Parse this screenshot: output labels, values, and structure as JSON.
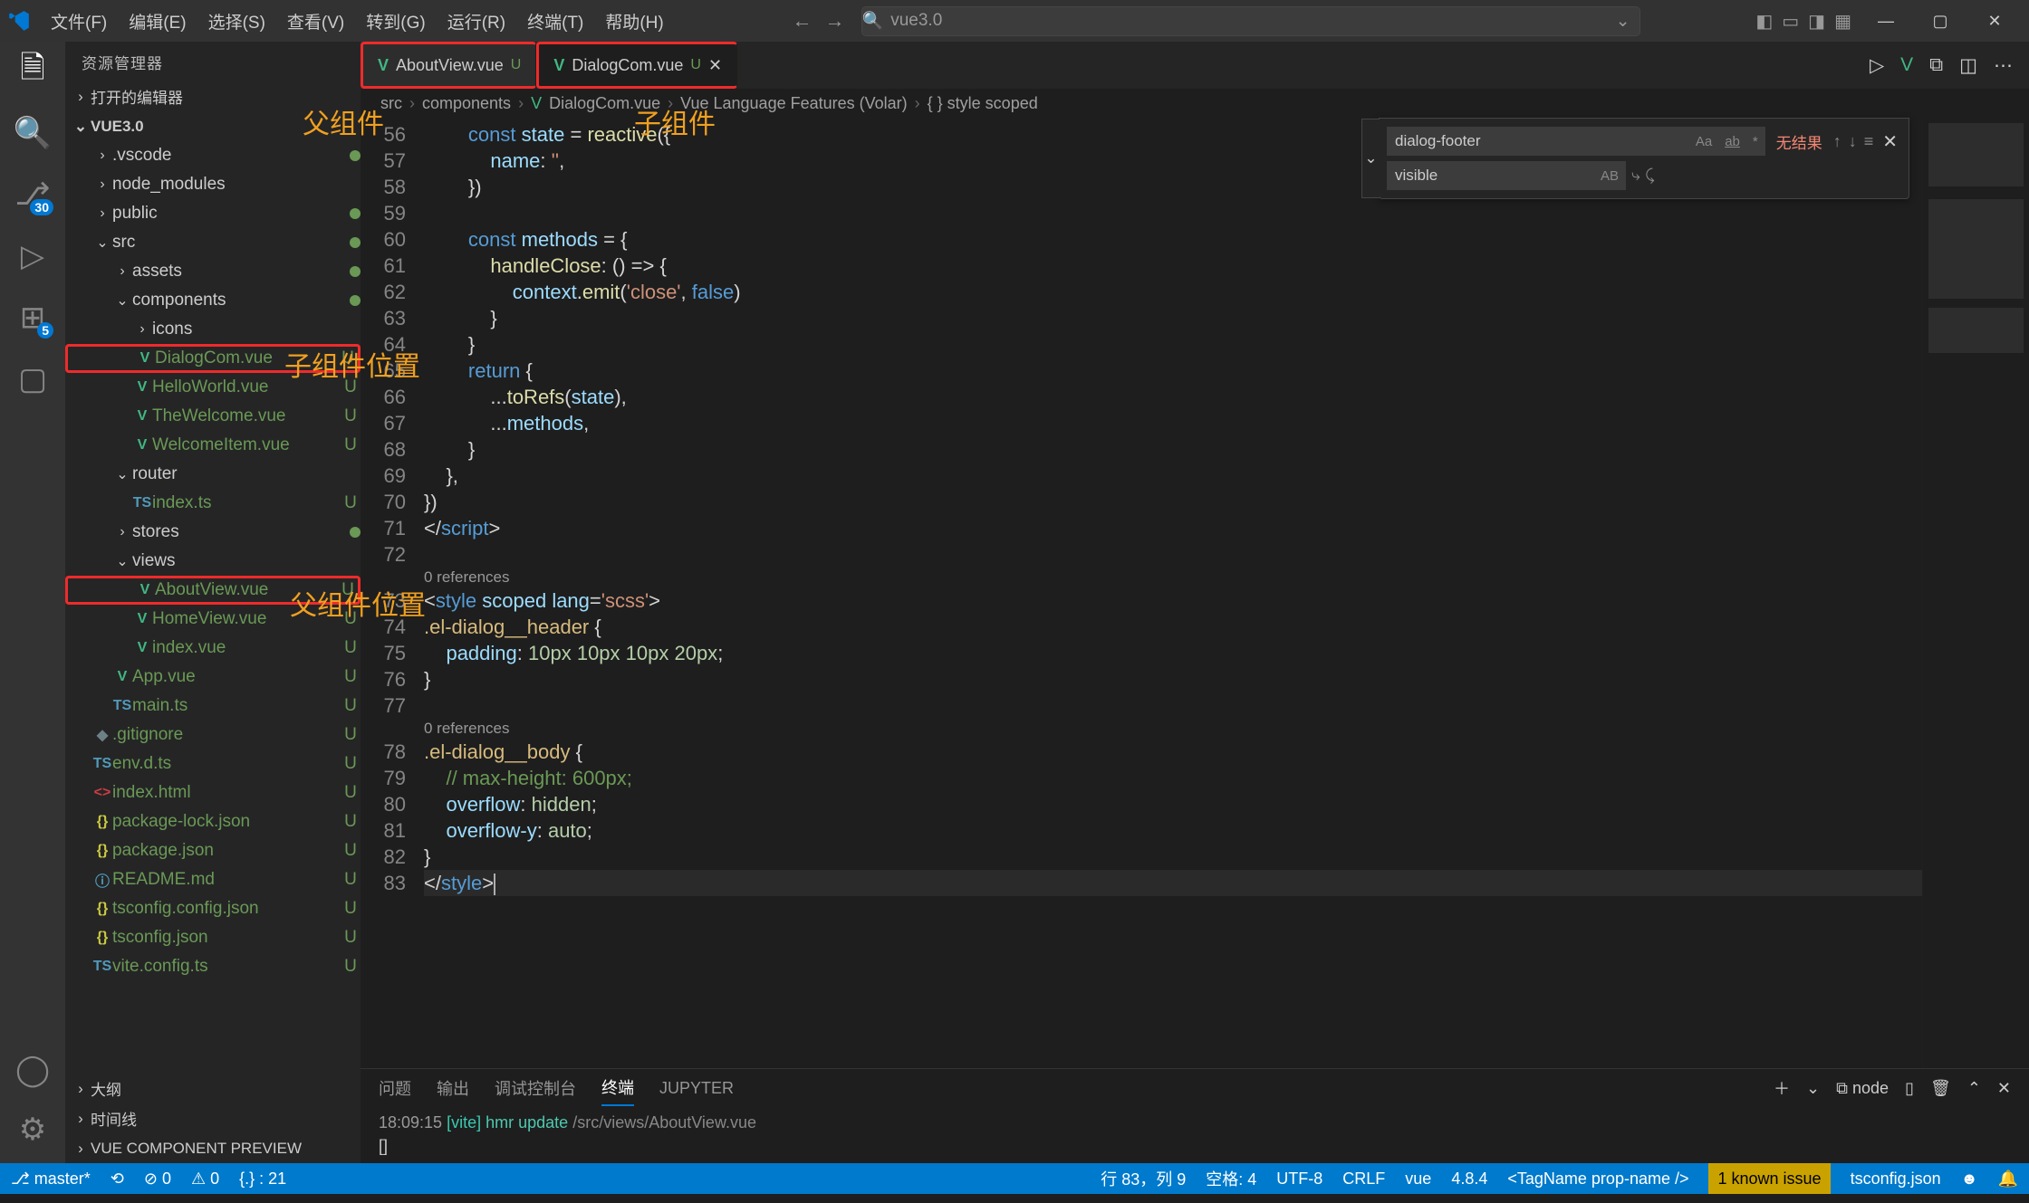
{
  "title": "vue3.0",
  "menu": [
    "文件(F)",
    "编辑(E)",
    "选择(S)",
    "查看(V)",
    "转到(G)",
    "运行(R)",
    "终端(T)",
    "帮助(H)"
  ],
  "search_placeholder": "vue3.0",
  "sidebar_title": "资源管理器",
  "sections": {
    "open_editors": "打开的编辑器",
    "project": "VUE3.0",
    "outline": "大纲",
    "timeline": "时间线",
    "vcp": "VUE COMPONENT PREVIEW"
  },
  "tree": [
    {
      "d": 1,
      "t": "folder",
      "open": false,
      "lbl": ".vscode",
      "dot": true
    },
    {
      "d": 1,
      "t": "folder",
      "open": false,
      "lbl": "node_modules"
    },
    {
      "d": 1,
      "t": "folder",
      "open": false,
      "lbl": "public",
      "dot": true
    },
    {
      "d": 1,
      "t": "folder",
      "open": true,
      "lbl": "src",
      "dot": true
    },
    {
      "d": 2,
      "t": "folder",
      "open": false,
      "lbl": "assets",
      "dot": true
    },
    {
      "d": 2,
      "t": "folder",
      "open": true,
      "lbl": "components",
      "dot": true
    },
    {
      "d": 3,
      "t": "folder",
      "open": false,
      "lbl": "icons",
      "em": true
    },
    {
      "d": 3,
      "t": "vue",
      "lbl": "DialogCom.vue",
      "git": "U",
      "hl": true,
      "red": true
    },
    {
      "d": 3,
      "t": "vue",
      "lbl": "HelloWorld.vue",
      "git": "U"
    },
    {
      "d": 3,
      "t": "vue",
      "lbl": "TheWelcome.vue",
      "git": "U"
    },
    {
      "d": 3,
      "t": "vue",
      "lbl": "WelcomeItem.vue",
      "git": "U"
    },
    {
      "d": 2,
      "t": "folder",
      "open": true,
      "lbl": "router"
    },
    {
      "d": 3,
      "t": "ts",
      "lbl": "index.ts",
      "git": "U"
    },
    {
      "d": 2,
      "t": "folder",
      "open": false,
      "lbl": "stores",
      "dot": true
    },
    {
      "d": 2,
      "t": "folder",
      "open": true,
      "lbl": "views"
    },
    {
      "d": 3,
      "t": "vue",
      "lbl": "AboutView.vue",
      "git": "U",
      "red": true
    },
    {
      "d": 3,
      "t": "vue",
      "lbl": "HomeView.vue",
      "git": "U"
    },
    {
      "d": 3,
      "t": "vue",
      "lbl": "index.vue",
      "git": "U"
    },
    {
      "d": 2,
      "t": "vue",
      "lbl": "App.vue",
      "git": "U"
    },
    {
      "d": 2,
      "t": "ts",
      "lbl": "main.ts",
      "git": "U"
    },
    {
      "d": 1,
      "t": "git",
      "lbl": ".gitignore",
      "git": "U"
    },
    {
      "d": 1,
      "t": "ts",
      "lbl": "env.d.ts",
      "git": "U"
    },
    {
      "d": 1,
      "t": "html",
      "lbl": "index.html",
      "git": "U"
    },
    {
      "d": 1,
      "t": "json",
      "lbl": "package-lock.json",
      "git": "U"
    },
    {
      "d": 1,
      "t": "json",
      "lbl": "package.json",
      "git": "U"
    },
    {
      "d": 1,
      "t": "md",
      "lbl": "README.md",
      "git": "U"
    },
    {
      "d": 1,
      "t": "json",
      "lbl": "tsconfig.config.json",
      "git": "U"
    },
    {
      "d": 1,
      "t": "json",
      "lbl": "tsconfig.json",
      "git": "U"
    },
    {
      "d": 1,
      "t": "ts",
      "lbl": "vite.config.ts",
      "git": "U"
    }
  ],
  "tabs": [
    {
      "lbl": "AboutView.vue",
      "mod": "U",
      "active": false,
      "red": true
    },
    {
      "lbl": "DialogCom.vue",
      "mod": "U",
      "active": true,
      "close": true,
      "red": true
    }
  ],
  "breadcrumb": [
    "src",
    "components",
    "DialogCom.vue",
    "Vue Language Features (Volar)",
    "{ } style scoped"
  ],
  "find": {
    "term": "dialog-footer",
    "replace": "visible",
    "result": "无结果",
    "opts": {
      "case": "Aa",
      "word": "ab",
      "regex": "*",
      "preserve": "AB"
    }
  },
  "code": {
    "start": 56,
    "lines": [
      {
        "n": 56,
        "h": "        <span class='c-kw'>const</span> <span class='c-var'>state</span> <span class='c-pun'>=</span> <span class='c-fn'>reactive</span><span class='c-pun'>({</span>"
      },
      {
        "n": 57,
        "h": "            <span class='c-var'>name</span><span class='c-pun'>:</span> <span class='c-str'>''</span><span class='c-pun'>,</span>"
      },
      {
        "n": 58,
        "h": "        <span class='c-pun'>})</span>"
      },
      {
        "n": 59,
        "h": ""
      },
      {
        "n": 60,
        "h": "        <span class='c-kw'>const</span> <span class='c-var'>methods</span> <span class='c-pun'>= {</span>"
      },
      {
        "n": 61,
        "h": "            <span class='c-fn'>handleClose</span><span class='c-pun'>: () =&gt; {</span>"
      },
      {
        "n": 62,
        "h": "                <span class='c-var'>context</span><span class='c-pun'>.</span><span class='c-fn'>emit</span><span class='c-pun'>(</span><span class='c-str'>'close'</span><span class='c-pun'>,</span> <span class='c-const'>false</span><span class='c-pun'>)</span>"
      },
      {
        "n": 63,
        "h": "            <span class='c-pun'>}</span>"
      },
      {
        "n": 64,
        "h": "        <span class='c-pun'>}</span>"
      },
      {
        "n": 65,
        "h": "        <span class='c-kw'>return</span> <span class='c-pun'>{</span>"
      },
      {
        "n": 66,
        "h": "            <span class='c-pun'>...</span><span class='c-fn'>toRefs</span><span class='c-pun'>(</span><span class='c-var'>state</span><span class='c-pun'>),</span>"
      },
      {
        "n": 67,
        "h": "            <span class='c-pun'>...</span><span class='c-var'>methods</span><span class='c-pun'>,</span>"
      },
      {
        "n": 68,
        "h": "        <span class='c-pun'>}</span>"
      },
      {
        "n": 69,
        "h": "    <span class='c-pun'>},</span>"
      },
      {
        "n": 70,
        "h": "<span class='c-pun'>})</span>"
      },
      {
        "n": 71,
        "h": "<span class='c-pun'>&lt;/</span><span class='c-tag'>script</span><span class='c-pun'>&gt;</span>"
      },
      {
        "n": 72,
        "h": ""
      },
      {
        "n": 73,
        "h": "<span class='c-pun'>&lt;</span><span class='c-tag'>style</span> <span class='c-attr'>scoped</span> <span class='c-attr'>lang</span><span class='c-pun'>=</span><span class='c-str'>'scss'</span><span class='c-pun'>&gt;</span>",
        "lens": "0 references"
      },
      {
        "n": 74,
        "h": "<span class='c-sel'>.el-dialog__header</span> <span class='c-pun'>{</span>"
      },
      {
        "n": 75,
        "h": "    <span class='c-prop'>padding</span><span class='c-pun'>:</span> <span class='c-num'>10px 10px 10px 20px</span><span class='c-pun'>;</span>"
      },
      {
        "n": 76,
        "h": "<span class='c-pun'>}</span>"
      },
      {
        "n": 77,
        "h": ""
      },
      {
        "n": 78,
        "h": "<span class='c-sel'>.el-dialog__body</span> <span class='c-pun'>{</span>",
        "lens": "0 references"
      },
      {
        "n": 79,
        "h": "    <span class='c-cmt'>// max-height: 600px;</span>"
      },
      {
        "n": 80,
        "h": "    <span class='c-prop'>overflow</span><span class='c-pun'>:</span> <span class='c-num'>hidden</span><span class='c-pun'>;</span>"
      },
      {
        "n": 81,
        "h": "    <span class='c-prop'>overflow-y</span><span class='c-pun'>:</span> <span class='c-num'>auto</span><span class='c-pun'>;</span>"
      },
      {
        "n": 82,
        "h": "<span class='c-pun'>}</span>"
      },
      {
        "n": 83,
        "h": "<span class='c-pun'>&lt;/</span><span class='c-tag'>style</span><span class='c-pun'>&gt;</span><span class='cursor'></span>",
        "cur": true
      }
    ]
  },
  "panel": {
    "tabs": [
      "问题",
      "输出",
      "调试控制台",
      "终端",
      "JUPYTER"
    ],
    "active": 3,
    "node": "node",
    "log_time": "18:09:15",
    "log_tag": "[vite]",
    "log_msg": "hmr update",
    "log_path": "/src/views/AboutView.vue",
    "prompt": "[]"
  },
  "status": {
    "branch": "master*",
    "sync": "⟲",
    "err": "⊘ 0",
    "warn": "⚠ 0",
    "braces": "{.} : 21",
    "pos": "行 83，列 9",
    "spaces": "空格: 4",
    "enc": "UTF-8",
    "eol": "CRLF",
    "lang": "vue",
    "ver": "4.8.4",
    "tag": "<TagName prop-name />",
    "issue": "1 known issue",
    "tsconf": "tsconfig.json"
  },
  "annotations": {
    "parent": "父组件",
    "child": "子组件",
    "child_loc": "子组件位置",
    "parent_loc": "父组件位置"
  },
  "activity_badges": {
    "scm": "30",
    "ext": "5"
  }
}
